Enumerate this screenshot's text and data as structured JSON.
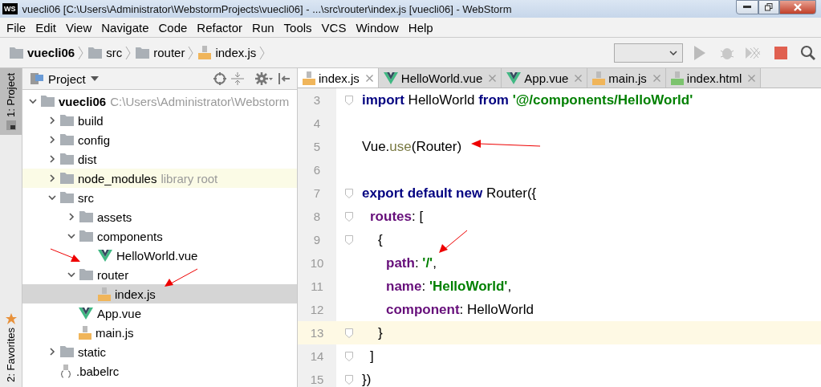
{
  "window": {
    "title": "vuecli06 [C:\\Users\\Administrator\\WebstormProjects\\vuecli06] - ...\\src\\router\\index.js [vuecli06] - WebStorm",
    "app_badge": "WS"
  },
  "menu": [
    "File",
    "Edit",
    "View",
    "Navigate",
    "Code",
    "Refactor",
    "Run",
    "Tools",
    "VCS",
    "Window",
    "Help"
  ],
  "breadcrumbs": [
    {
      "label": "vuecli06",
      "kind": "folder",
      "bold": true
    },
    {
      "label": "src",
      "kind": "folder",
      "bold": false
    },
    {
      "label": "router",
      "kind": "folder",
      "bold": false
    },
    {
      "label": "index.js",
      "kind": "js",
      "bold": false
    }
  ],
  "side_strip": [
    {
      "label": "1: Project",
      "selected": true
    },
    {
      "label": "2: Favorites",
      "selected": false
    }
  ],
  "project_panel": {
    "title": "Project"
  },
  "tree": [
    {
      "label": "vuecli06",
      "hint": "C:\\Users\\Administrator\\Webstorm",
      "kind": "folder",
      "bold": true,
      "expanded": true,
      "selected": false,
      "children": [
        {
          "label": "build",
          "kind": "folder",
          "expanded": false,
          "selected": false
        },
        {
          "label": "config",
          "kind": "folder",
          "expanded": false,
          "selected": false
        },
        {
          "label": "dist",
          "kind": "folder",
          "expanded": false,
          "selected": false
        },
        {
          "label": "node_modules",
          "hint": "library root",
          "kind": "folder",
          "expanded": false,
          "selected": false
        },
        {
          "label": "src",
          "kind": "folder",
          "expanded": true,
          "selected": false,
          "children": [
            {
              "label": "assets",
              "kind": "folder",
              "expanded": false,
              "selected": false
            },
            {
              "label": "components",
              "kind": "folder",
              "expanded": true,
              "selected": false,
              "children": [
                {
                  "label": "HelloWorld.vue",
                  "kind": "vue",
                  "selected": false
                }
              ]
            },
            {
              "label": "router",
              "kind": "folder",
              "expanded": true,
              "selected": false,
              "children": [
                {
                  "label": "index.js",
                  "kind": "js",
                  "selected": true
                }
              ]
            },
            {
              "label": "App.vue",
              "kind": "vue",
              "selected": false
            },
            {
              "label": "main.js",
              "kind": "js",
              "selected": false
            }
          ]
        },
        {
          "label": "static",
          "kind": "folder",
          "expanded": false,
          "selected": false
        },
        {
          "label": ".babelrc",
          "kind": "config",
          "selected": false
        }
      ]
    }
  ],
  "tabs": [
    {
      "label": "index.js",
      "kind": "js",
      "selected": true
    },
    {
      "label": "HelloWorld.vue",
      "kind": "vue",
      "selected": false
    },
    {
      "label": "App.vue",
      "kind": "vue",
      "selected": false
    },
    {
      "label": "main.js",
      "kind": "js",
      "selected": false
    },
    {
      "label": "index.html",
      "kind": "html",
      "selected": false
    }
  ],
  "code": [
    {
      "number": "3",
      "current": false,
      "fold": true,
      "tokens": [
        {
          "kind": "keyword",
          "text": "import"
        },
        {
          "kind": "plain",
          "text": " HelloWorld "
        },
        {
          "kind": "keyword",
          "text": "from"
        },
        {
          "kind": "string",
          "text": " '@/components/HelloWorld'"
        }
      ]
    },
    {
      "number": "4",
      "current": false,
      "fold": false
    },
    {
      "number": "5",
      "current": false,
      "fold": false,
      "tokens": [
        {
          "kind": "plain",
          "text": "Vue."
        },
        {
          "kind": "method",
          "text": "use"
        },
        {
          "kind": "plain",
          "text": "(Router)"
        }
      ]
    },
    {
      "number": "6",
      "current": false,
      "fold": false
    },
    {
      "number": "7",
      "current": false,
      "fold": true,
      "tokens": [
        {
          "kind": "keyword",
          "text": "export default new"
        },
        {
          "kind": "plain",
          "text": " Router({"
        }
      ],
      "children": [
        {
          "number": "8",
          "current": false,
          "fold": true,
          "tokens": [
            {
              "kind": "prop",
              "text": "routes"
            },
            {
              "kind": "plain",
              "text": ": ["
            }
          ],
          "children": [
            {
              "number": "9",
              "current": false,
              "fold": true,
              "tokens": [
                {
                  "kind": "plain",
                  "text": "{"
                }
              ],
              "children": [
                {
                  "number": "10",
                  "current": false,
                  "fold": false,
                  "tokens": [
                    {
                      "kind": "prop",
                      "text": "path"
                    },
                    {
                      "kind": "plain",
                      "text": ": "
                    },
                    {
                      "kind": "string",
                      "text": "'/'"
                    },
                    {
                      "kind": "plain",
                      "text": ","
                    }
                  ]
                },
                {
                  "number": "11",
                  "current": false,
                  "fold": false,
                  "tokens": [
                    {
                      "kind": "prop",
                      "text": "name"
                    },
                    {
                      "kind": "plain",
                      "text": ": "
                    },
                    {
                      "kind": "string",
                      "text": "'HelloWorld'"
                    },
                    {
                      "kind": "plain",
                      "text": ","
                    }
                  ]
                },
                {
                  "number": "12",
                  "current": false,
                  "fold": false,
                  "tokens": [
                    {
                      "kind": "prop",
                      "text": "component"
                    },
                    {
                      "kind": "plain",
                      "text": ": HelloWorld"
                    }
                  ]
                }
              ]
            },
            {
              "number": "13",
              "current": true,
              "fold": true,
              "tokens": [
                {
                  "kind": "plain",
                  "text": "}"
                }
              ]
            }
          ]
        },
        {
          "number": "14",
          "current": false,
          "fold": true,
          "tokens": [
            {
              "kind": "plain",
              "text": "]"
            }
          ]
        }
      ]
    },
    {
      "number": "15",
      "current": false,
      "fold": true,
      "tokens": [
        {
          "kind": "plain",
          "text": "})"
        }
      ]
    }
  ]
}
